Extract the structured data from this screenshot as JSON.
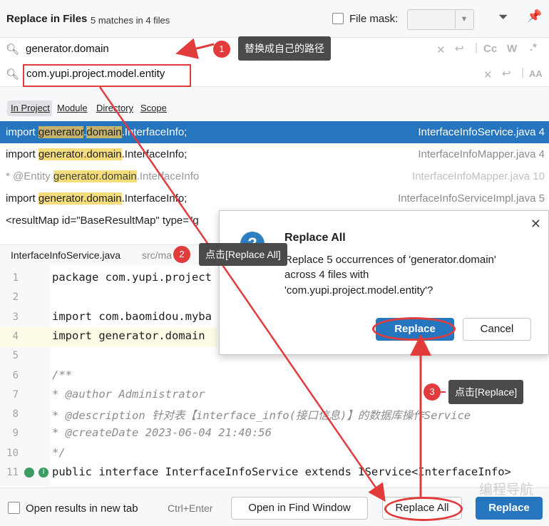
{
  "header": {
    "title": "Replace in Files",
    "matches": "5 matches in 4 files",
    "file_mask_label": "File mask:",
    "file_mask_value": ""
  },
  "find": {
    "value": "generator.domain"
  },
  "replace": {
    "value": "com.yupi.project.model.entity"
  },
  "options": {
    "case": "Cc",
    "words": "W",
    "regex": ".*",
    "preserve_case": "AA"
  },
  "scopes": [
    "In Project",
    "Module",
    "Directory",
    "Scope"
  ],
  "results": [
    {
      "prefix": "import ",
      "hl1": "generator",
      "dot": ".",
      "hl2": "domain",
      "suffix": ".InterfaceInfo;",
      "file": "InterfaceInfoService.java 4"
    },
    {
      "prefix": "import ",
      "hl1": "generator",
      "dot": ".",
      "hl2": "domain",
      "suffix": ".InterfaceInfo;",
      "file": "InterfaceInfoMapper.java 4"
    },
    {
      "prefix": "* @Entity ",
      "hl1": "generator",
      "dot": ".",
      "hl2": "domain",
      "suffix": ".InterfaceInfo",
      "file": "InterfaceInfoMapper.java 10"
    },
    {
      "prefix": "import ",
      "hl1": "generator",
      "dot": ".",
      "hl2": "domain",
      "suffix": ".InterfaceInfo;",
      "file": "InterfaceInfoServiceImpl.java 5"
    },
    {
      "prefix": "<resultMap id=\"BaseResultMap\" type=\"g",
      "hl1": "",
      "dot": "",
      "hl2": "",
      "suffix": "",
      "file": ""
    }
  ],
  "preview": {
    "filename": "InterfaceInfoService.java",
    "path": "src/ma"
  },
  "code_lines": [
    {
      "n": "1",
      "t": "package com.yupi.project"
    },
    {
      "n": "2",
      "t": ""
    },
    {
      "n": "3",
      "t": "import com.baomidou.myba"
    },
    {
      "n": "4",
      "t": "import generator.domain"
    },
    {
      "n": "5",
      "t": ""
    },
    {
      "n": "6",
      "t": "/**"
    },
    {
      "n": "7",
      "t": "* @author Administrator"
    },
    {
      "n": "8",
      "t": "* @description 针对表【interface_info(接口信息)】的数据库操作Service"
    },
    {
      "n": "9",
      "t": "* @createDate 2023-06-04 21:40:56"
    },
    {
      "n": "10",
      "t": "*/"
    },
    {
      "n": "11",
      "t": "public interface InterfaceInfoService extends IService<InterfaceInfo>"
    }
  ],
  "dialog": {
    "title": "Replace All",
    "message_line1": "Replace 5 occurrences of 'generator.domain'",
    "message_line2": "across 4 files with",
    "message_line3": "'com.yupi.project.model.entity'?",
    "replace_label": "Replace",
    "cancel_label": "Cancel"
  },
  "footer": {
    "open_new_tab": "Open results in new tab",
    "shortcut": "Ctrl+Enter",
    "open_find_window": "Open in Find Window",
    "replace_all": "Replace All",
    "replace": "Replace"
  },
  "annotations": {
    "step1_num": "1",
    "step1_text": "替换成自己的路径",
    "step2_num": "2",
    "step2_text": "点击[Replace All]",
    "step3_num": "3",
    "step3_text": "点击[Replace]",
    "watermark": "编程导航"
  },
  "colors": {
    "accent": "#2675bf",
    "selection": "#2675bf",
    "highlight": "#f6dd7c",
    "annotation_red": "#e23b3b"
  }
}
